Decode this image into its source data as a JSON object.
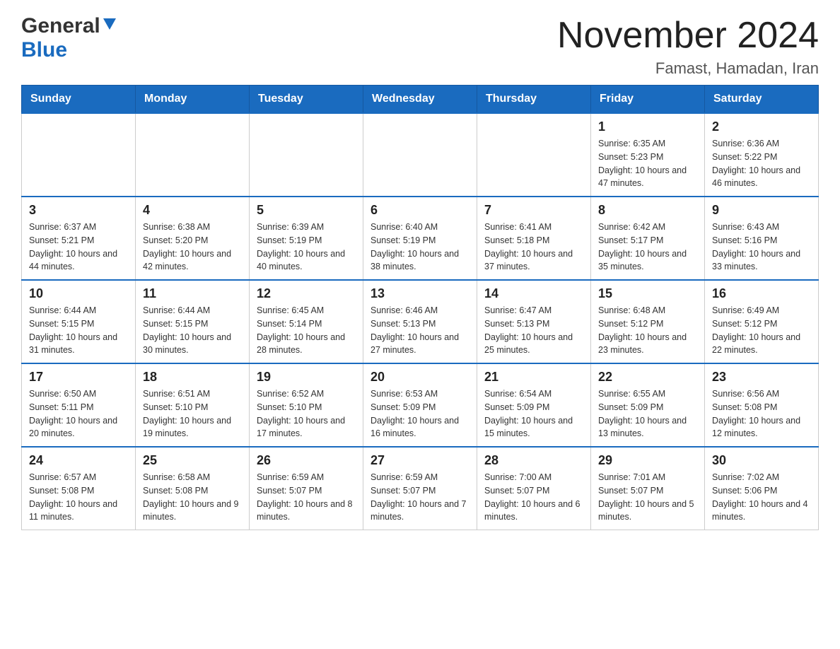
{
  "header": {
    "logo_general": "General",
    "logo_blue": "Blue",
    "month_title": "November 2024",
    "location": "Famast, Hamadan, Iran"
  },
  "calendar": {
    "days_of_week": [
      "Sunday",
      "Monday",
      "Tuesday",
      "Wednesday",
      "Thursday",
      "Friday",
      "Saturday"
    ],
    "weeks": [
      [
        {
          "day": "",
          "info": ""
        },
        {
          "day": "",
          "info": ""
        },
        {
          "day": "",
          "info": ""
        },
        {
          "day": "",
          "info": ""
        },
        {
          "day": "",
          "info": ""
        },
        {
          "day": "1",
          "info": "Sunrise: 6:35 AM\nSunset: 5:23 PM\nDaylight: 10 hours and 47 minutes."
        },
        {
          "day": "2",
          "info": "Sunrise: 6:36 AM\nSunset: 5:22 PM\nDaylight: 10 hours and 46 minutes."
        }
      ],
      [
        {
          "day": "3",
          "info": "Sunrise: 6:37 AM\nSunset: 5:21 PM\nDaylight: 10 hours and 44 minutes."
        },
        {
          "day": "4",
          "info": "Sunrise: 6:38 AM\nSunset: 5:20 PM\nDaylight: 10 hours and 42 minutes."
        },
        {
          "day": "5",
          "info": "Sunrise: 6:39 AM\nSunset: 5:19 PM\nDaylight: 10 hours and 40 minutes."
        },
        {
          "day": "6",
          "info": "Sunrise: 6:40 AM\nSunset: 5:19 PM\nDaylight: 10 hours and 38 minutes."
        },
        {
          "day": "7",
          "info": "Sunrise: 6:41 AM\nSunset: 5:18 PM\nDaylight: 10 hours and 37 minutes."
        },
        {
          "day": "8",
          "info": "Sunrise: 6:42 AM\nSunset: 5:17 PM\nDaylight: 10 hours and 35 minutes."
        },
        {
          "day": "9",
          "info": "Sunrise: 6:43 AM\nSunset: 5:16 PM\nDaylight: 10 hours and 33 minutes."
        }
      ],
      [
        {
          "day": "10",
          "info": "Sunrise: 6:44 AM\nSunset: 5:15 PM\nDaylight: 10 hours and 31 minutes."
        },
        {
          "day": "11",
          "info": "Sunrise: 6:44 AM\nSunset: 5:15 PM\nDaylight: 10 hours and 30 minutes."
        },
        {
          "day": "12",
          "info": "Sunrise: 6:45 AM\nSunset: 5:14 PM\nDaylight: 10 hours and 28 minutes."
        },
        {
          "day": "13",
          "info": "Sunrise: 6:46 AM\nSunset: 5:13 PM\nDaylight: 10 hours and 27 minutes."
        },
        {
          "day": "14",
          "info": "Sunrise: 6:47 AM\nSunset: 5:13 PM\nDaylight: 10 hours and 25 minutes."
        },
        {
          "day": "15",
          "info": "Sunrise: 6:48 AM\nSunset: 5:12 PM\nDaylight: 10 hours and 23 minutes."
        },
        {
          "day": "16",
          "info": "Sunrise: 6:49 AM\nSunset: 5:12 PM\nDaylight: 10 hours and 22 minutes."
        }
      ],
      [
        {
          "day": "17",
          "info": "Sunrise: 6:50 AM\nSunset: 5:11 PM\nDaylight: 10 hours and 20 minutes."
        },
        {
          "day": "18",
          "info": "Sunrise: 6:51 AM\nSunset: 5:10 PM\nDaylight: 10 hours and 19 minutes."
        },
        {
          "day": "19",
          "info": "Sunrise: 6:52 AM\nSunset: 5:10 PM\nDaylight: 10 hours and 17 minutes."
        },
        {
          "day": "20",
          "info": "Sunrise: 6:53 AM\nSunset: 5:09 PM\nDaylight: 10 hours and 16 minutes."
        },
        {
          "day": "21",
          "info": "Sunrise: 6:54 AM\nSunset: 5:09 PM\nDaylight: 10 hours and 15 minutes."
        },
        {
          "day": "22",
          "info": "Sunrise: 6:55 AM\nSunset: 5:09 PM\nDaylight: 10 hours and 13 minutes."
        },
        {
          "day": "23",
          "info": "Sunrise: 6:56 AM\nSunset: 5:08 PM\nDaylight: 10 hours and 12 minutes."
        }
      ],
      [
        {
          "day": "24",
          "info": "Sunrise: 6:57 AM\nSunset: 5:08 PM\nDaylight: 10 hours and 11 minutes."
        },
        {
          "day": "25",
          "info": "Sunrise: 6:58 AM\nSunset: 5:08 PM\nDaylight: 10 hours and 9 minutes."
        },
        {
          "day": "26",
          "info": "Sunrise: 6:59 AM\nSunset: 5:07 PM\nDaylight: 10 hours and 8 minutes."
        },
        {
          "day": "27",
          "info": "Sunrise: 6:59 AM\nSunset: 5:07 PM\nDaylight: 10 hours and 7 minutes."
        },
        {
          "day": "28",
          "info": "Sunrise: 7:00 AM\nSunset: 5:07 PM\nDaylight: 10 hours and 6 minutes."
        },
        {
          "day": "29",
          "info": "Sunrise: 7:01 AM\nSunset: 5:07 PM\nDaylight: 10 hours and 5 minutes."
        },
        {
          "day": "30",
          "info": "Sunrise: 7:02 AM\nSunset: 5:06 PM\nDaylight: 10 hours and 4 minutes."
        }
      ]
    ]
  }
}
